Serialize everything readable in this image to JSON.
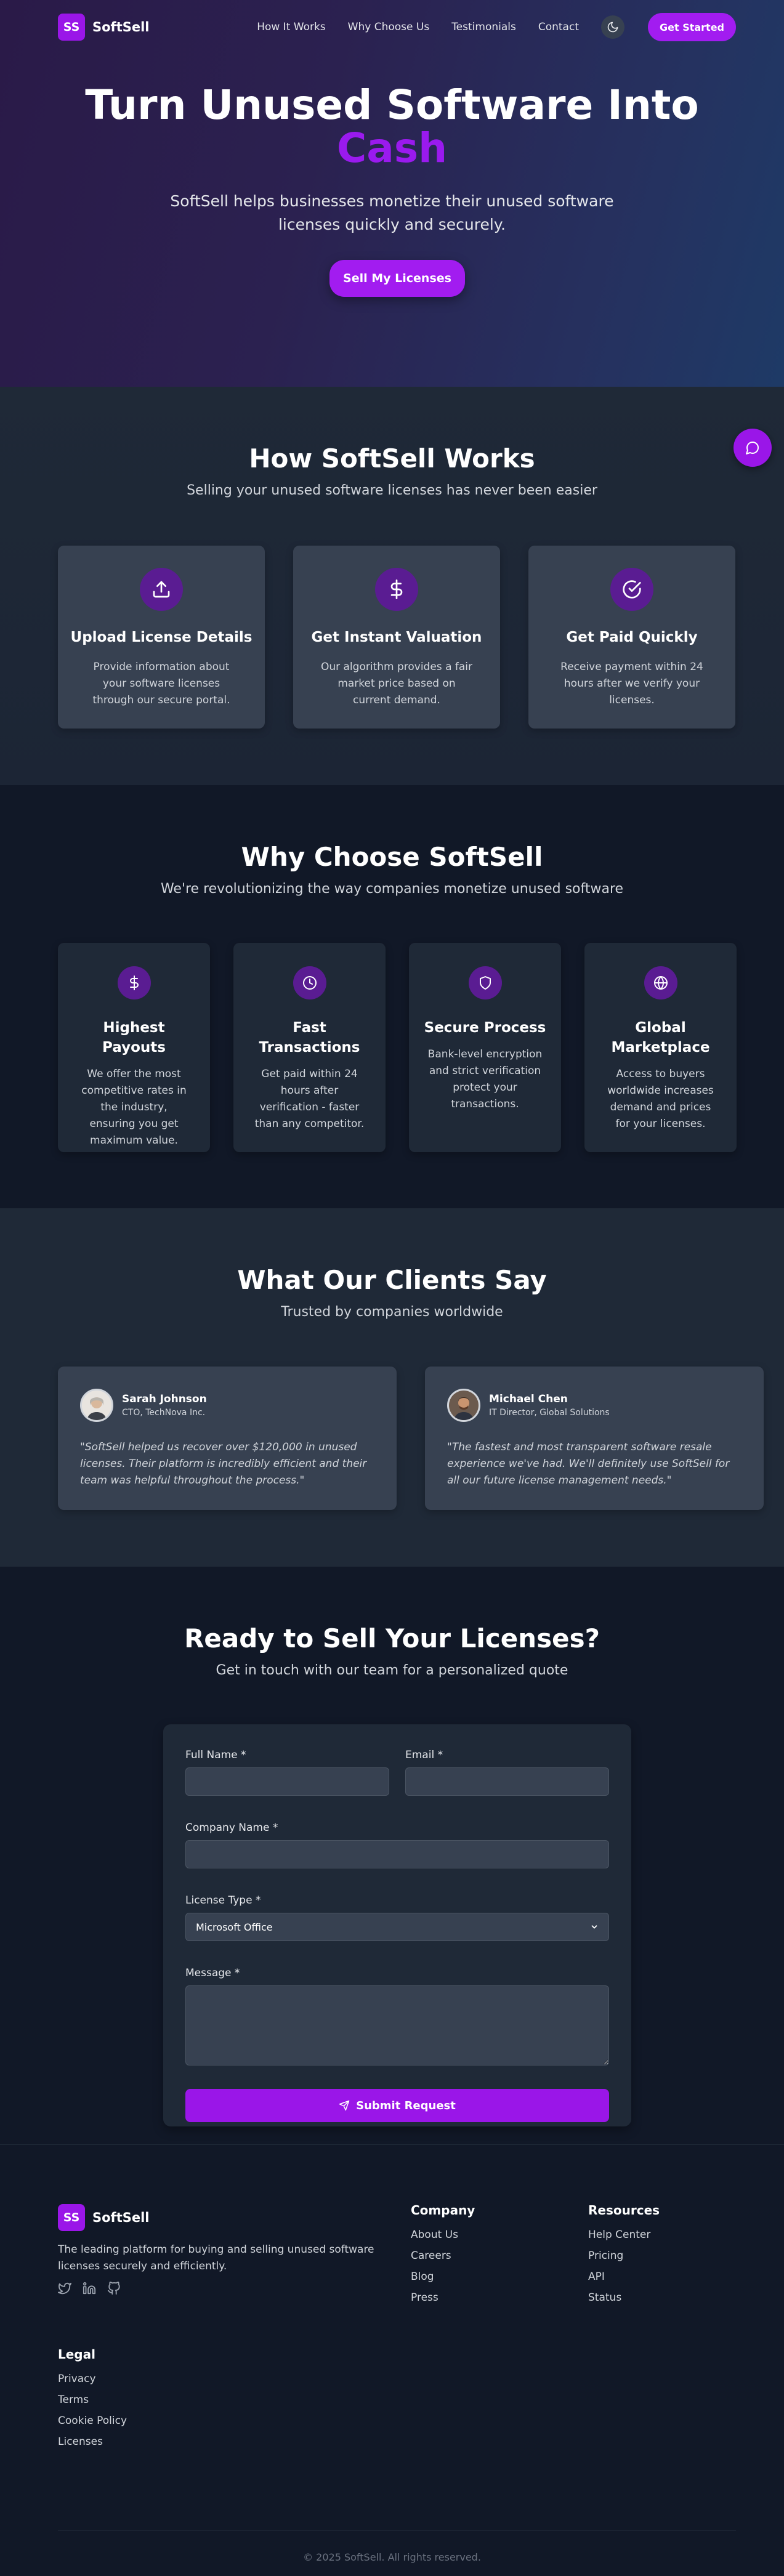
{
  "header": {
    "logo_text": "SS",
    "brand": "SoftSell",
    "nav": [
      "How It Works",
      "Why Choose Us",
      "Testimonials",
      "Contact"
    ],
    "cta": "Get Started"
  },
  "hero": {
    "title": "Turn Unused Software Into",
    "title_accent": "Cash",
    "subtitle": "SoftSell helps businesses monetize their unused software licenses quickly and securely.",
    "cta": "Sell My Licenses"
  },
  "how": {
    "title": "How SoftSell Works",
    "subtitle": "Selling your unused software licenses has never been easier",
    "cards": [
      {
        "icon": "upload-icon",
        "title": "Upload License Details",
        "text": "Provide information about your software licenses through our secure portal."
      },
      {
        "icon": "dollar-icon",
        "title": "Get Instant Valuation",
        "text": "Our algorithm provides a fair market price based on current demand."
      },
      {
        "icon": "check-circle-icon",
        "title": "Get Paid Quickly",
        "text": "Receive payment within 24 hours after we verify your licenses."
      }
    ]
  },
  "why": {
    "title": "Why Choose SoftSell",
    "subtitle": "We're revolutionizing the way companies monetize unused software",
    "cards": [
      {
        "icon": "dollar-icon",
        "title": "Highest Payouts",
        "text": "We offer the most competitive rates in the industry, ensuring you get maximum value."
      },
      {
        "icon": "clock-icon",
        "title": "Fast Transactions",
        "text": "Get paid within 24 hours after verification - faster than any competitor."
      },
      {
        "icon": "shield-icon",
        "title": "Secure Process",
        "text": "Bank-level encryption and strict verification protect your transactions."
      },
      {
        "icon": "globe-icon",
        "title": "Global Marketplace",
        "text": "Access to buyers worldwide increases demand and prices for your licenses."
      }
    ]
  },
  "testimonials": {
    "title": "What Our Clients Say",
    "subtitle": "Trusted by companies worldwide",
    "items": [
      {
        "name": "Sarah Johnson",
        "role": "CTO, TechNova Inc.",
        "quote": "\"SoftSell helped us recover over $120,000 in unused licenses. Their platform is incredibly efficient and their team was helpful throughout the process.\""
      },
      {
        "name": "Michael Chen",
        "role": "IT Director, Global Solutions",
        "quote": "\"The fastest and most transparent software resale experience we've had. We'll definitely use SoftSell for all our future license management needs.\""
      }
    ]
  },
  "contact": {
    "title": "Ready to Sell Your Licenses?",
    "subtitle": "Get in touch with our team for a personalized quote",
    "labels": {
      "name": "Full Name *",
      "email": "Email *",
      "company": "Company Name *",
      "license_type": "License Type *",
      "message": "Message *"
    },
    "values": {
      "name": "",
      "email": "",
      "company": "",
      "message": ""
    },
    "license_selected": "Microsoft Office",
    "submit": "Submit Request"
  },
  "footer": {
    "logo_text": "SS",
    "brand": "SoftSell",
    "description": "The leading platform for buying and selling unused software licenses securely and efficiently.",
    "social_icons": [
      "twitter-icon",
      "linkedin-icon",
      "github-icon"
    ],
    "company": {
      "title": "Company",
      "links": [
        "About Us",
        "Careers",
        "Blog",
        "Press"
      ]
    },
    "resources": {
      "title": "Resources",
      "links": [
        "Help Center",
        "Pricing",
        "API",
        "Status"
      ]
    },
    "legal": {
      "title": "Legal",
      "links": [
        "Privacy",
        "Terms",
        "Cookie Policy",
        "Licenses"
      ]
    },
    "copyright": "© 2025 SoftSell. All rights reserved."
  },
  "colors": {
    "accent": "#9a16e8",
    "card": "#374151",
    "bg_dark": "#111827",
    "bg_mid": "#1f2937"
  }
}
